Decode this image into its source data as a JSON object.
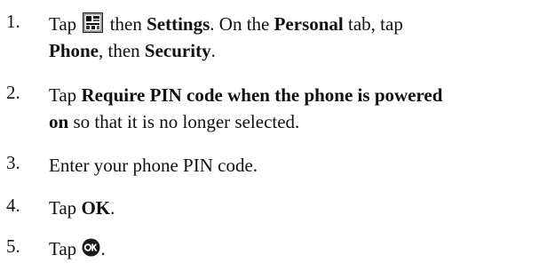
{
  "steps": [
    {
      "number": "1.",
      "lines": [
        {
          "a": "Tap ",
          "icon": "start-menu-icon",
          "b": " then ",
          "c": "Settings",
          "d": ". On the ",
          "e": "Personal",
          "f": " tab, tap"
        },
        {
          "a": "Phone",
          "b": ", then ",
          "c": "Security",
          "d": "."
        }
      ]
    },
    {
      "number": "2.",
      "lines": [
        {
          "a": "Tap ",
          "b": "Require PIN code when the phone is powered"
        },
        {
          "a": "on",
          "b": " so that it is no longer selected."
        }
      ]
    },
    {
      "number": "3.",
      "lines": [
        {
          "a": "Enter your phone PIN code."
        }
      ]
    },
    {
      "number": "4.",
      "lines": [
        {
          "a": "Tap ",
          "b": "OK",
          "c": "."
        }
      ]
    },
    {
      "number": "5.",
      "lines": [
        {
          "a": "Tap ",
          "icon": "ok-button-icon",
          "b": "."
        }
      ]
    }
  ]
}
